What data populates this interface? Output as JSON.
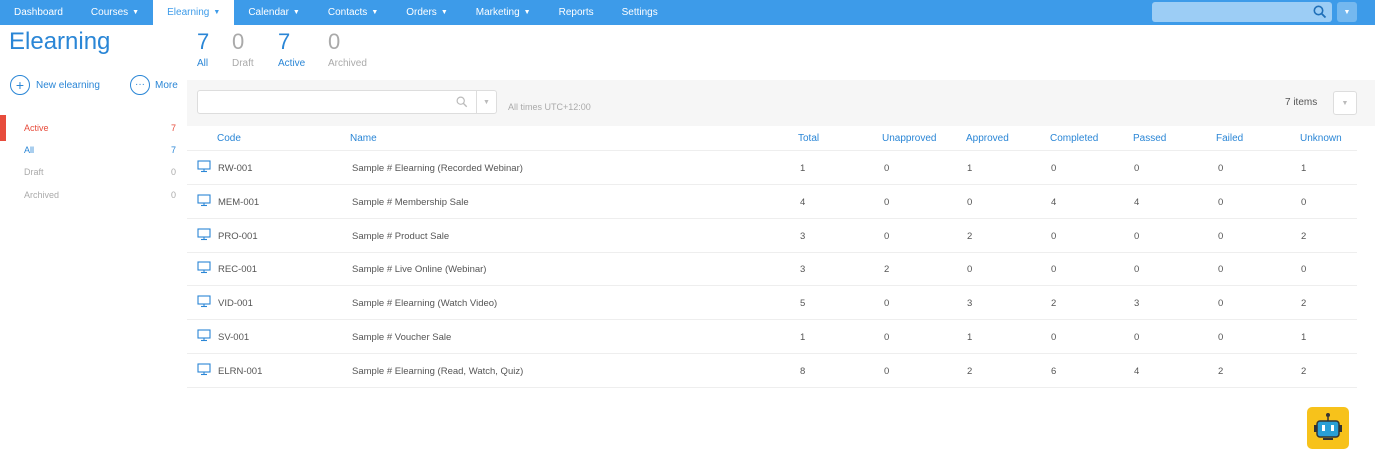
{
  "nav": {
    "items": [
      {
        "label": "Dashboard",
        "caret": false
      },
      {
        "label": "Courses",
        "caret": true
      },
      {
        "label": "Elearning",
        "caret": true,
        "active": true
      },
      {
        "label": "Calendar",
        "caret": true
      },
      {
        "label": "Contacts",
        "caret": true
      },
      {
        "label": "Orders",
        "caret": true
      },
      {
        "label": "Marketing",
        "caret": true
      },
      {
        "label": "Reports",
        "caret": false
      },
      {
        "label": "Settings",
        "caret": false
      }
    ],
    "search_icon": "search-icon",
    "caret_glyph": "▼"
  },
  "page": {
    "title": "Elearning",
    "actions": {
      "new_label": "New elearning",
      "more_label": "More"
    }
  },
  "sidebar": {
    "items": [
      {
        "label": "Active",
        "count": "7"
      },
      {
        "label": "All",
        "count": "7"
      },
      {
        "label": "Draft",
        "count": "0"
      },
      {
        "label": "Archived",
        "count": "0"
      }
    ]
  },
  "stats": [
    {
      "num": "7",
      "label": "All"
    },
    {
      "num": "0",
      "label": "Draft"
    },
    {
      "num": "7",
      "label": "Active"
    },
    {
      "num": "0",
      "label": "Archived"
    }
  ],
  "filter": {
    "search_placeholder": "",
    "timezone": "All times UTC+12:00",
    "items_count": "7 items"
  },
  "table": {
    "columns": [
      "Code",
      "Name",
      "Total",
      "Unapproved",
      "Approved",
      "Completed",
      "Passed",
      "Failed",
      "Unknown"
    ],
    "rows": [
      [
        "RW-001",
        "Sample # Elearning (Recorded Webinar)",
        "1",
        "0",
        "1",
        "0",
        "0",
        "0",
        "1"
      ],
      [
        "MEM-001",
        "Sample # Membership Sale",
        "4",
        "0",
        "0",
        "4",
        "4",
        "0",
        "0"
      ],
      [
        "PRO-001",
        "Sample # Product Sale",
        "3",
        "0",
        "2",
        "0",
        "0",
        "0",
        "2"
      ],
      [
        "REC-001",
        "Sample # Live Online (Webinar)",
        "3",
        "2",
        "0",
        "0",
        "0",
        "0",
        "0"
      ],
      [
        "VID-001",
        "Sample # Elearning (Watch Video)",
        "5",
        "0",
        "3",
        "2",
        "3",
        "0",
        "2"
      ],
      [
        "SV-001",
        "Sample # Voucher Sale",
        "1",
        "0",
        "1",
        "0",
        "0",
        "0",
        "1"
      ],
      [
        "ELRN-001",
        "Sample # Elearning (Read, Watch, Quiz)",
        "8",
        "0",
        "2",
        "6",
        "4",
        "2",
        "2"
      ]
    ]
  },
  "colors": {
    "nav_bg": "#3d9be9",
    "accent": "#2a86d6",
    "active_red": "#e74c3c",
    "bot_yellow": "#f7c21b"
  }
}
